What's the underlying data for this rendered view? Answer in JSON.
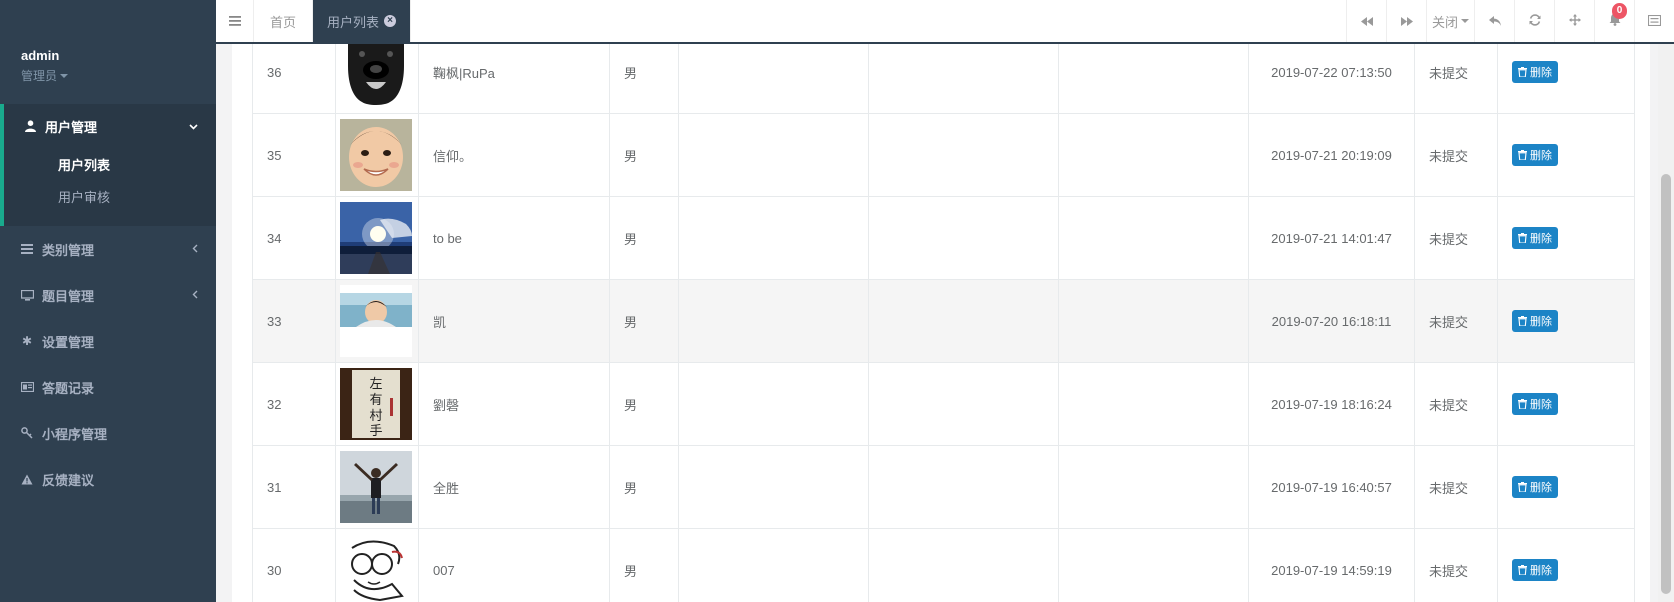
{
  "sidebar": {
    "user": {
      "name": "admin",
      "role": "管理员"
    },
    "group": {
      "label": "用户管理",
      "icon": "user-icon",
      "items": [
        {
          "label": "用户列表",
          "active": true
        },
        {
          "label": "用户审核",
          "active": false
        }
      ]
    },
    "items": [
      {
        "label": "类别管理",
        "icon": "bars-icon"
      },
      {
        "label": "题目管理",
        "icon": "desktop-icon"
      },
      {
        "label": "设置管理",
        "icon": "asterisk-icon"
      },
      {
        "label": "答题记录",
        "icon": "newspaper-icon"
      },
      {
        "label": "小程序管理",
        "icon": "key-icon"
      },
      {
        "label": "反馈建议",
        "icon": "warning-icon"
      }
    ]
  },
  "topbar": {
    "tabs": [
      {
        "label": "首页",
        "active": false
      },
      {
        "label": "用户列表",
        "active": true
      }
    ],
    "close_label": "关闭",
    "notification_count": "0"
  },
  "table": {
    "delete_label": "删除",
    "rows": [
      {
        "id": "36",
        "name": "鞠枫|RuPa",
        "gender": "男",
        "time": "2019-07-22 07:13:50",
        "status": "未提交",
        "avatar": "dog"
      },
      {
        "id": "35",
        "name": "信仰。",
        "gender": "男",
        "time": "2019-07-21 20:19:09",
        "status": "未提交",
        "avatar": "child"
      },
      {
        "id": "34",
        "name": "to be",
        "gender": "男",
        "time": "2019-07-21 14:01:47",
        "status": "未提交",
        "avatar": "sky"
      },
      {
        "id": "33",
        "name": "凯",
        "gender": "男",
        "time": "2019-07-20 16:18:11",
        "status": "未提交",
        "avatar": "boy"
      },
      {
        "id": "32",
        "name": "劉磬",
        "gender": "男",
        "time": "2019-07-19 18:16:24",
        "status": "未提交",
        "avatar": "calligraphy"
      },
      {
        "id": "31",
        "name": "全胜",
        "gender": "男",
        "time": "2019-07-19 16:40:57",
        "status": "未提交",
        "avatar": "beach"
      },
      {
        "id": "30",
        "name": "007",
        "gender": "男",
        "time": "2019-07-19 14:59:19",
        "status": "未提交",
        "avatar": "sketch"
      }
    ]
  },
  "colors": {
    "sidebar_bg": "#2f4050",
    "accent": "#19aa8d",
    "button_blue": "#1c84c6",
    "badge_red": "#ed5565"
  }
}
